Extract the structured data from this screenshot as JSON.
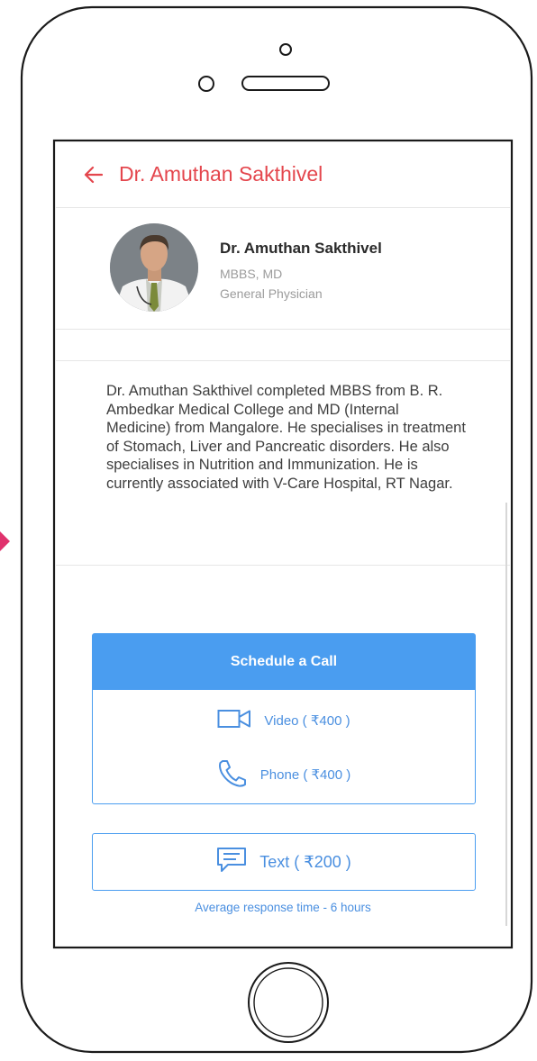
{
  "appbar": {
    "title": "Dr. Amuthan Sakthivel"
  },
  "doctor": {
    "name": "Dr. Amuthan Sakthivel",
    "degree": "MBBS, MD",
    "specialty": "General Physician",
    "bio": "Dr. Amuthan Sakthivel completed MBBS from B. R. Ambedkar Medical College and MD (Internal Medicine) from Mangalore. He specialises in treatment of Stomach, Liver and Pancreatic disorders. He also specialises in Nutrition and Immunization. He is currently associated with V-Care Hospital, RT Nagar."
  },
  "schedule": {
    "header": "Schedule a Call",
    "video_label": "Video ( ₹400 )",
    "phone_label": "Phone ( ₹400 )"
  },
  "text_consult": {
    "label": "Text ( ₹200 )",
    "response_time": "Average response time - 6 hours"
  },
  "icons": {
    "back": "arrow-left-icon",
    "video": "video-camera-icon",
    "phone": "phone-icon",
    "text": "chat-bubble-icon"
  },
  "colors": {
    "accent_red": "#e4464d",
    "accent_blue": "#4a9df0",
    "marker_pink": "#e0326d"
  }
}
